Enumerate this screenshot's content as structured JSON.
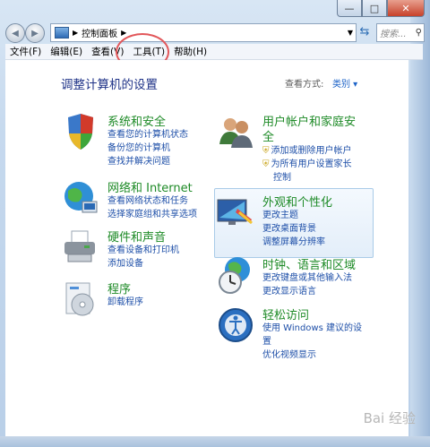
{
  "window": {
    "minimize": "—",
    "maximize": "□",
    "close": "✕"
  },
  "address": {
    "path": "控制面板",
    "search_placeholder": "搜索..."
  },
  "menu": [
    "文件(F)",
    "编辑(E)",
    "查看(V)",
    "工具(T)",
    "帮助(H)"
  ],
  "content": {
    "title": "调整计算机的设置",
    "view_by_label": "查看方式:",
    "view_by_value": "类别 ▾"
  },
  "categories": {
    "system": {
      "heading": "系统和安全",
      "links": [
        "查看您的计算机状态",
        "备份您的计算机",
        "查找并解决问题"
      ]
    },
    "network": {
      "heading": "网络和 Internet",
      "links": [
        "查看网络状态和任务",
        "选择家庭组和共享选项"
      ]
    },
    "hardware": {
      "heading": "硬件和声音",
      "links": [
        "查看设备和打印机",
        "添加设备"
      ]
    },
    "programs": {
      "heading": "程序",
      "links": [
        "卸载程序"
      ]
    },
    "users": {
      "heading_1": "用户帐户和家庭安",
      "heading_2": "全",
      "links": [
        "添加或删除用户帐户",
        "为所有用户设置家长",
        "控制"
      ]
    },
    "appearance": {
      "heading": "外观和个性化",
      "links": [
        "更改主题",
        "更改桌面背景",
        "调整屏幕分辨率"
      ]
    },
    "clock": {
      "heading": "时钟、语言和区域",
      "links": [
        "更改键盘或其他输入法",
        "更改显示语言"
      ]
    },
    "ease": {
      "heading": "轻松访问",
      "links": [
        "使用 Windows 建议的设",
        "置",
        "优化视频显示"
      ]
    }
  },
  "watermark": "Bai 经验"
}
